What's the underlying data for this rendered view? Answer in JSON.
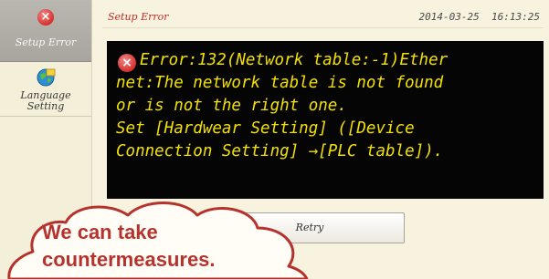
{
  "sidebar": {
    "items": [
      {
        "label": "Setup Error",
        "icon": "error-icon",
        "active": true
      },
      {
        "label": "Language\nSetting",
        "icon": "language-globe-icon",
        "active": false
      }
    ]
  },
  "header": {
    "title": "Setup Error",
    "date": "2014-03-25",
    "time": "16:13:25"
  },
  "message": {
    "icon": "error-icon",
    "lines": [
      "Error:132(Network table:-1)Ether",
      "net:The network table is not found",
      "or is not the right one.",
      "Set [Hardwear Setting] ([Device",
      "Connection Setting] →[PLC table])."
    ]
  },
  "retry_button": {
    "label": "Retry"
  },
  "callout": {
    "lines": [
      "We can take",
      "countermeasures."
    ]
  },
  "colors": {
    "message_text": "#f2e000",
    "message_bg": "#050505",
    "header_title": "#c0302c",
    "callout_text": "#b5332e",
    "callout_border": "#b5332e"
  }
}
